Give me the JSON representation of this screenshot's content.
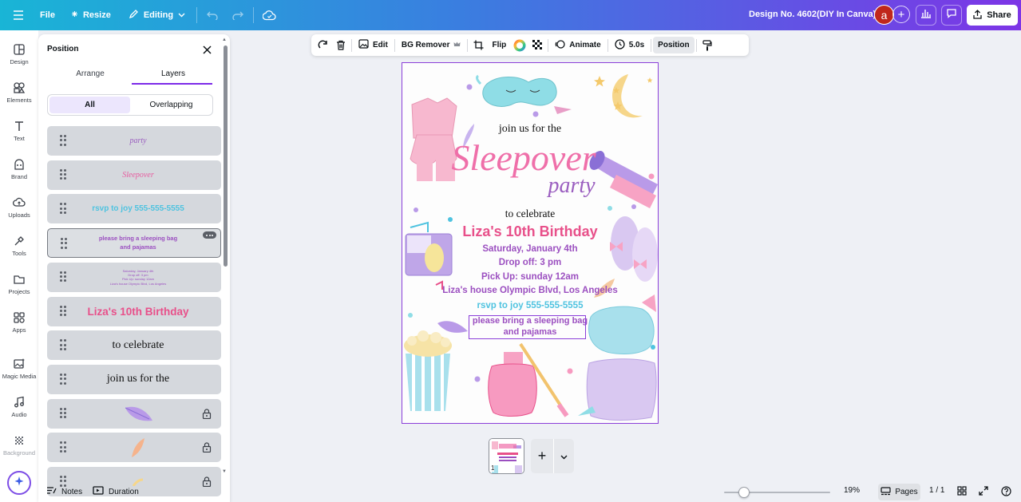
{
  "topbar": {
    "file_label": "File",
    "resize_label": "Resize",
    "mode_label": "Editing",
    "design_title": "Design No. 4602(DIY In Canva)",
    "avatar_initial": "a",
    "share_label": "Share"
  },
  "rail": {
    "items": [
      {
        "label": "Design",
        "icon": "design-icon"
      },
      {
        "label": "Elements",
        "icon": "elements-icon"
      },
      {
        "label": "Text",
        "icon": "text-icon"
      },
      {
        "label": "Brand",
        "icon": "brand-icon"
      },
      {
        "label": "Uploads",
        "icon": "uploads-icon"
      },
      {
        "label": "Tools",
        "icon": "tools-icon"
      },
      {
        "label": "Projects",
        "icon": "projects-icon"
      },
      {
        "label": "Apps",
        "icon": "apps-icon"
      },
      {
        "label": "Magic Media",
        "icon": "magic-media-icon"
      },
      {
        "label": "Audio",
        "icon": "audio-icon"
      },
      {
        "label": "Background",
        "icon": "background-icon"
      }
    ]
  },
  "panel": {
    "title": "Position",
    "tabs": [
      "Arrange",
      "Layers"
    ],
    "active_tab": "Layers",
    "filters": [
      "All",
      "Overlapping"
    ],
    "active_filter": "All",
    "layers": [
      {
        "text": "party",
        "color": "#9b5fc0",
        "kind": "script"
      },
      {
        "text": "Sleepover",
        "color": "#e85a9e",
        "kind": "script"
      },
      {
        "text": "rsvp to joy 555-555-5555",
        "color": "#4fc3e0",
        "kind": "hand"
      },
      {
        "text": "please bring a sleeping bag\nand pajamas",
        "color": "#9b4fc0",
        "kind": "hand-small",
        "selected": true
      },
      {
        "text": "Saturday, January 4th\nDrop off: 3 pm\nPick Up: sunday 12am\nLiza's house Olympic Blvd, Los Angeles",
        "color": "#9b4fc0",
        "kind": "tiny"
      },
      {
        "text": "Liza's 10th Birthday",
        "color": "#e8508a",
        "kind": "bold"
      },
      {
        "text": "to celebrate",
        "color": "#111111",
        "kind": "serif"
      },
      {
        "text": "join us for the",
        "color": "#111111",
        "kind": "serif"
      },
      {
        "text": "",
        "kind": "image-feather-purple",
        "locked": true
      },
      {
        "text": "",
        "kind": "image-feather-orange",
        "locked": true
      },
      {
        "text": "",
        "kind": "image-partial",
        "locked": true
      }
    ]
  },
  "context_toolbar": {
    "edit_label": "Edit",
    "bg_remover_label": "BG Remover",
    "flip_label": "Flip",
    "animate_label": "Animate",
    "duration_label": "5.0s",
    "position_label": "Position"
  },
  "canvas": {
    "join_text": "join us for the",
    "title_script": "Sleepover",
    "subtitle_script": "party",
    "celebrate_text": "to celebrate",
    "birthday_text": "Liza's 10th Birthday",
    "date_text": "Saturday, January 4th",
    "dropoff_text": "Drop off: 3 pm",
    "pickup_text": "Pick Up: sunday 12am",
    "address_text": "Liza's house Olympic Blvd, Los Angeles",
    "rsvp_text": "rsvp to joy 555-555-5555",
    "bring_line1": "please bring a sleeping bag",
    "bring_line2": "and pajamas",
    "colors": {
      "pink": "#e8508a",
      "purple": "#9b4fc0",
      "cyan": "#4fc3e0",
      "selection": "#8b3fd9"
    }
  },
  "pages_strip": {
    "thumb_number": "1"
  },
  "bottombar": {
    "notes_label": "Notes",
    "duration_label": "Duration",
    "zoom_percent": "19%",
    "zoom_value": 0.19,
    "pages_label": "Pages",
    "page_count": "1 / 1"
  }
}
